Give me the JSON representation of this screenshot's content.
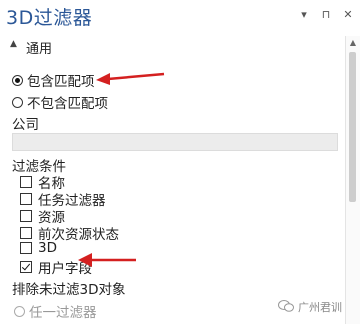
{
  "title": "3D过滤器",
  "titlebar_icons": [
    "▾",
    "⊓",
    "✕"
  ],
  "section": {
    "label": "通用"
  },
  "radio_group_1": [
    {
      "label": "包含匹配项",
      "checked": true
    },
    {
      "label": "不包含匹配项",
      "checked": false
    }
  ],
  "company": {
    "label": "公司",
    "value": ""
  },
  "filter_conditions": {
    "label": "过滤条件",
    "items": [
      {
        "label": "名称",
        "checked": false
      },
      {
        "label": "任务过滤器",
        "checked": false
      },
      {
        "label": "资源",
        "checked": false
      },
      {
        "label": "前次资源状态",
        "checked": false
      },
      {
        "label": "3D",
        "checked": false
      },
      {
        "label": "用户字段",
        "checked": true
      }
    ]
  },
  "exclude": {
    "label": "排除未过滤3D对象",
    "option": "任一过滤器"
  },
  "watermark": "广州君训",
  "colors": {
    "title": "#2b5797",
    "arrow": "#d42020"
  }
}
